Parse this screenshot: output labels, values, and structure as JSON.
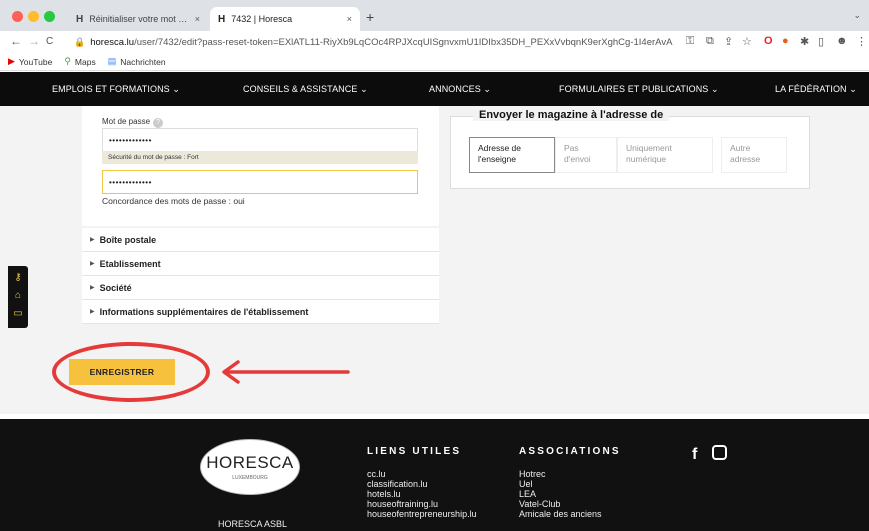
{
  "browser": {
    "tabs": [
      {
        "favicon": "H",
        "title": "Réinitialiser votre mot de passe",
        "close": "×"
      },
      {
        "favicon": "H",
        "title": "7432 | Horesca",
        "close": "×"
      }
    ],
    "new_tab": "+",
    "tab_menu": "⌄",
    "nav": {
      "back": "←",
      "forward": "→",
      "reload": "C"
    },
    "url_host": "horesca.lu",
    "url_path": "/user/7432/edit?pass-reset-token=EXlATL11-RiyXb9LqCOc4RPJXcqUISgnvxmU1IDIbx35DH_PEXxVvbqnK9erXghCg-1I4erAvA",
    "bookmarks": [
      {
        "icon": "youtube-icon",
        "label": "YouTube"
      },
      {
        "icon": "maps-icon",
        "label": "Maps"
      },
      {
        "icon": "news-icon",
        "label": "Nachrichten"
      }
    ]
  },
  "site_nav": {
    "items": [
      "EMPLOIS ET FORMATIONS",
      "CONSEILS & ASSISTANCE",
      "ANNONCES",
      "FORMULAIRES ET PUBLICATIONS",
      "LA FÉDÉRATION"
    ],
    "chevron": "⌄"
  },
  "form": {
    "password_label": "Mot de passe",
    "help_symbol": "?",
    "password_value": "•••••••••••••",
    "strength_text": "Sécurité du mot de passe : Fort",
    "confirm_value": "•••••••••••••",
    "match_text": "Concordance des mots de passe : oui"
  },
  "accordion": [
    "Boîte postale",
    "Etablissement",
    "Société",
    "Informations supplémentaires de l'établissement"
  ],
  "magazine": {
    "title": "Envoyer le magazine à l'adresse de",
    "options": [
      {
        "line1": "Adresse de",
        "line2": "l'enseigne",
        "selected": true
      },
      {
        "line1": "Pas",
        "line2": "d'envoi",
        "selected": false
      },
      {
        "line1": "Uniquement",
        "line2": "numérique",
        "selected": false
      },
      {
        "line1": "Autre",
        "line2": "adresse",
        "selected": false
      }
    ]
  },
  "save_button": "ENREGISTRER",
  "annotation_color": "#e53a3a",
  "accent_color": "#f6c23e",
  "footer": {
    "logo_text": "HORESCA",
    "logo_sub": "LUXEMBOURG",
    "org_name": "HORESCA ASBL",
    "liens_title": "LIENS UTILES",
    "liens": [
      "cc.lu",
      "classification.lu",
      "hotels.lu",
      "houseoftraining.lu",
      "houseofentrepreneurship.lu"
    ],
    "assoc_title": "ASSOCIATIONS",
    "assocs": [
      "Hotrec",
      "Uel",
      "LEA",
      "Vatel-Club",
      "Amicale des anciens"
    ],
    "social": [
      "facebook-icon",
      "instagram-icon"
    ]
  }
}
